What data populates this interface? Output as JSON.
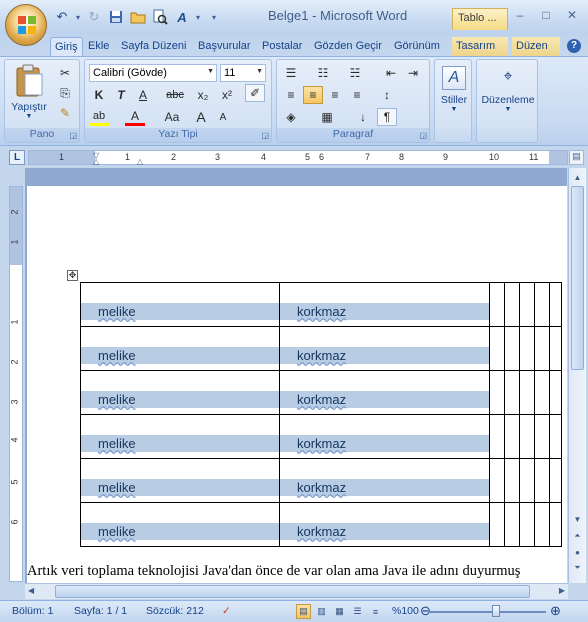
{
  "titlebar": {
    "title": "Belge1 - Microsoft Word",
    "context_tab_head": "Tablo ...",
    "minimize": "–",
    "maximize": "□",
    "close": "✕"
  },
  "qat": {
    "undo": "↶",
    "redo": "↻",
    "save": "▪",
    "open": "▭",
    "print_preview": "⌕",
    "spelling": "A",
    "customize": "▾"
  },
  "tabs": [
    "Giriş",
    "Ekle",
    "Sayfa Düzeni",
    "Başvurular",
    "Postalar",
    "Gözden Geçir",
    "Görünüm",
    "Tasarım",
    "Düzen"
  ],
  "help": "?",
  "ribbon": {
    "clipboard": {
      "label": "Pano",
      "paste": "Yapıştır",
      "cut": "✂",
      "copy": "⎘",
      "format_painter": "✎"
    },
    "font": {
      "label": "Yazı Tipi",
      "font_name": "Calibri (Gövde)",
      "font_size": "11",
      "bold": "K",
      "italic": "T",
      "underline": "A",
      "strikethrough": "abc",
      "subscript": "x₂",
      "superscript": "x²",
      "highlight": "ab",
      "font_color": "A",
      "change_case": "Aa",
      "grow": "A",
      "shrink": "A",
      "clear_format": "✐"
    },
    "paragraph": {
      "label": "Paragraf",
      "bullets": "☰",
      "numbering": "☷",
      "multilevel": "☵",
      "decrease_indent": "⇤",
      "increase_indent": "⇥",
      "align_left": "≡",
      "align_center": "≡",
      "align_right": "≡",
      "justify": "≡",
      "line_spacing": "↕",
      "shading": "◈",
      "borders": "▦",
      "sort": "↓",
      "show_marks": "¶"
    },
    "styles": {
      "label": "Stiller",
      "icon": "A"
    },
    "editing": {
      "label": "Düzenleme",
      "icon": "⌖"
    }
  },
  "ruler": {
    "corner": "L",
    "numbers": [
      "1",
      "1",
      "2",
      "3",
      "4",
      "5",
      "6",
      "7",
      "8",
      "9",
      "10",
      "11"
    ],
    "vnumbers": [
      "2",
      "1",
      "1",
      "2",
      "3",
      "4",
      "5",
      "6"
    ]
  },
  "document": {
    "table_rows": [
      [
        "melike",
        "korkmaz"
      ],
      [
        "melike",
        "korkmaz"
      ],
      [
        "melike",
        "korkmaz"
      ],
      [
        "melike",
        "korkmaz"
      ],
      [
        "melike",
        "korkmaz"
      ],
      [
        "melike",
        "korkmaz"
      ]
    ],
    "paragraph": "Artık veri toplama teknolojisi Java'dan önce de var olan ama Java ile adını duyurmuş"
  },
  "statusbar": {
    "section": "Bölüm: 1",
    "page": "Sayfa: 1 / 1",
    "words": "Sözcük: 212",
    "zoom": "%100",
    "zoom_out": "⊖",
    "zoom_in": "⊕"
  },
  "colors": {
    "ribbon_text": "#15428b",
    "cell_highlight": "#b8cce4",
    "context_tab": "#f5dc85"
  }
}
